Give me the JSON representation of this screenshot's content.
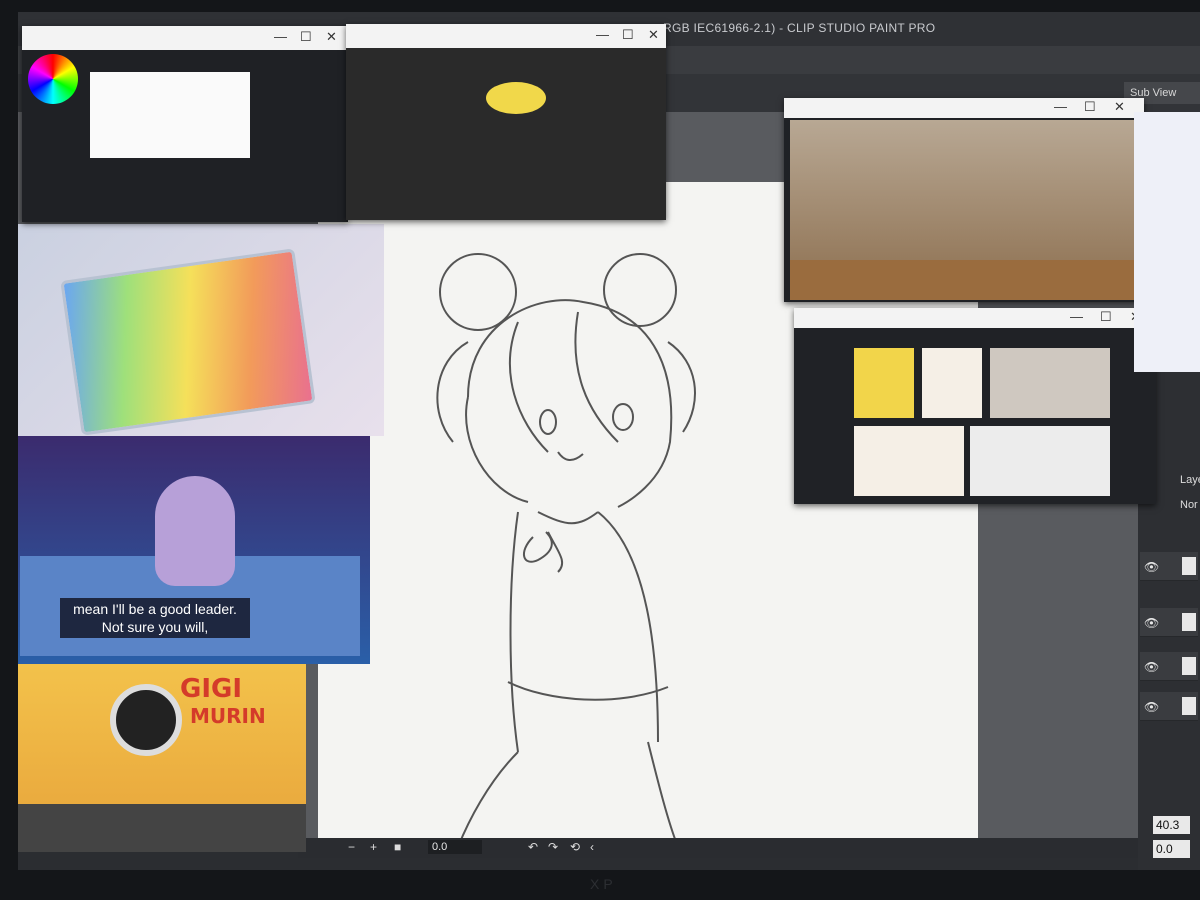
{
  "app": {
    "title": "RGB IEC61966-2.1) - CLIP STUDIO PAINT PRO",
    "sub_view_label": "Sub View"
  },
  "ref_windows": {
    "video_window": {
      "controls": [
        "—",
        "☐",
        "✕"
      ]
    },
    "screenshot_window": {
      "controls": [
        "—",
        "☐",
        "✕"
      ]
    },
    "paint_window": {
      "controls": [
        "—",
        "☐",
        "✕"
      ]
    },
    "blender_window": {
      "controls": [
        "—",
        "☐",
        "✕"
      ]
    }
  },
  "reference_images": {
    "cartoon_subtitle_line1": "mean I'll be a good leader.",
    "cartoon_subtitle_line2": "Not sure you will,",
    "logo_text_1": "GIGI",
    "logo_text_2": "MURIN"
  },
  "right_panel": {
    "layer_label": "Laye",
    "blend_label": "Nor",
    "zoom_value": "40.3",
    "angle_value": "0.0"
  },
  "bottom_bar": {
    "minus": "−",
    "plus": "+",
    "rotation_value": "0.0"
  },
  "bezel_logo": "XP"
}
